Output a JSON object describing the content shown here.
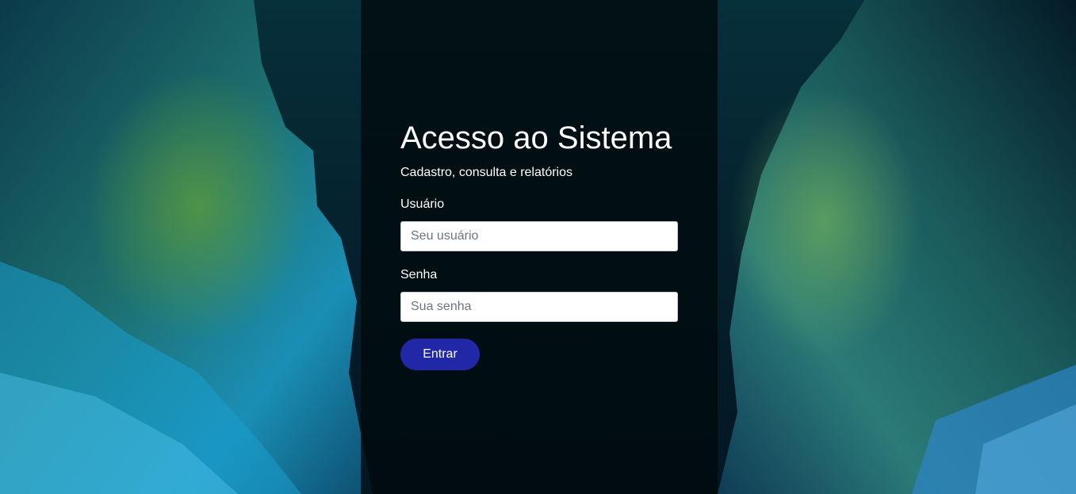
{
  "login": {
    "title": "Acesso ao Sistema",
    "subtitle": "Cadastro, consulta e relatórios",
    "username_label": "Usuário",
    "username_placeholder": "Seu usuário",
    "username_value": "",
    "password_label": "Senha",
    "password_placeholder": "Sua senha",
    "password_value": "",
    "submit_label": "Entrar"
  },
  "colors": {
    "button": "#2128a8",
    "panel": "#000a0c",
    "text": "#ffffff"
  }
}
